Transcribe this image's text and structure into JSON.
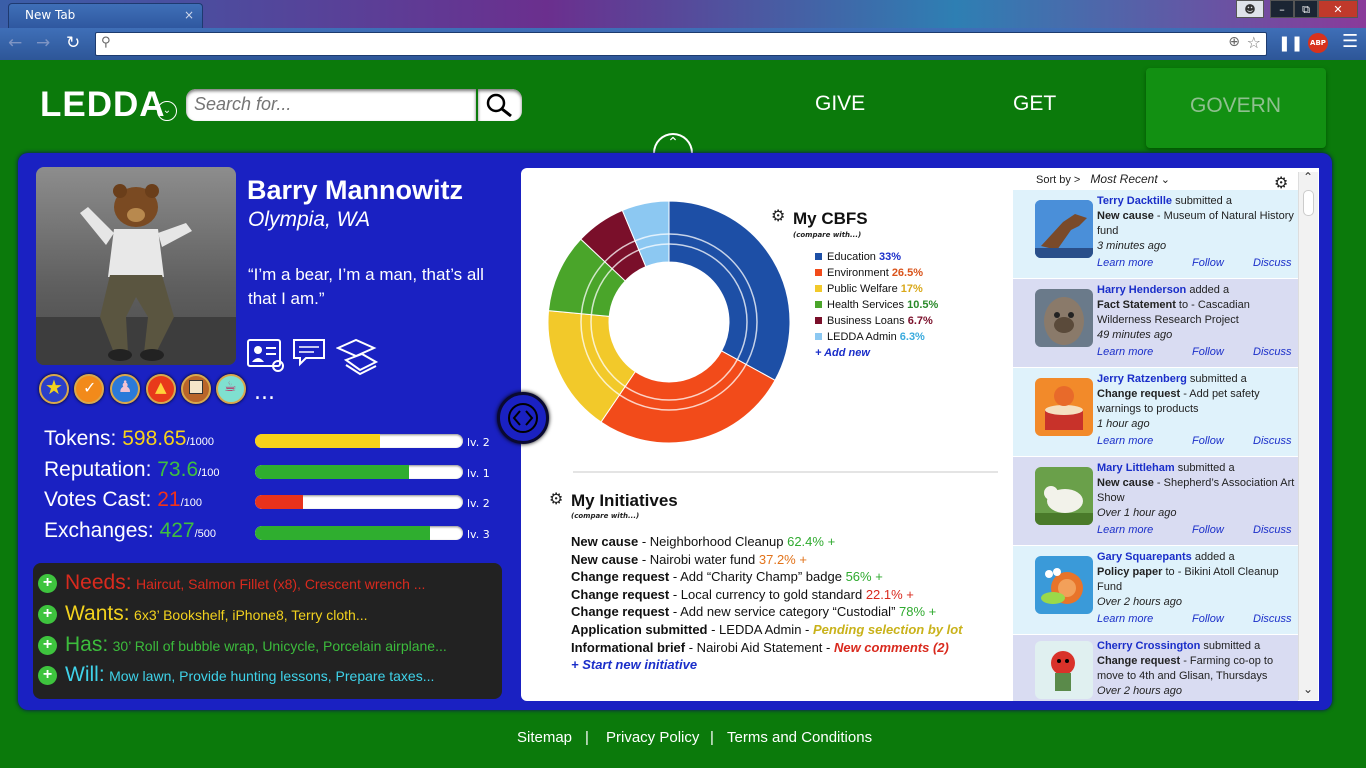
{
  "browser": {
    "tab_title": "New Tab",
    "tab_close": "×",
    "address": "",
    "extension_abp": "ABP"
  },
  "header": {
    "logo": "LEDDA",
    "search_placeholder": "Search for...",
    "nav": [
      {
        "label": "GIVE"
      },
      {
        "label": "GET"
      },
      {
        "label": "GOVERN",
        "active": true
      }
    ]
  },
  "profile": {
    "name": "Barry Mannowitz",
    "location": "Olympia, WA",
    "quote": "“I’m a bear, I’m a man, that’s all that I am.”",
    "icons": [
      "profile-settings-icon",
      "messages-icon",
      "education-icon"
    ],
    "badges": [
      "star-badge",
      "checkmark-badge",
      "person-badge",
      "fire-badge",
      "calendar-badge",
      "cup-badge"
    ],
    "badges_more": "...",
    "stats": [
      {
        "label": "Tokens: ",
        "value": "598.65",
        "max": "/1000",
        "level": "lv. 2",
        "fill": 0.6,
        "color": "#f7d21a"
      },
      {
        "label": "Reputation: ",
        "value": "73.6",
        "max": "/100",
        "level": "lv. 1",
        "fill": 0.74,
        "color": "#2fae2f"
      },
      {
        "label": "Votes Cast: ",
        "value": "21",
        "max": "/100",
        "level": "lv. 2",
        "fill": 0.23,
        "color": "#e8321c"
      },
      {
        "label": "Exchanges: ",
        "value": "427",
        "max": "/500",
        "level": "lv. 3",
        "fill": 0.84,
        "color": "#2fae2f"
      }
    ],
    "nwh": [
      {
        "key": "Needs:",
        "value": "Haircut, Salmon Fillet (x8), Crescent wrench ...",
        "color": "#d92a1e"
      },
      {
        "key": "Wants:",
        "value": "6x3’ Bookshelf, iPhone8, Terry cloth...",
        "color": "#f2d21e"
      },
      {
        "key": "Has:",
        "value": "30’ Roll of bubble wrap, Unicycle,  Porcelain airplane...",
        "color": "#3cbc3c"
      },
      {
        "key": "Will:",
        "value": "Mow lawn, Provide hunting lessons, Prepare taxes...",
        "color": "#3fd3ea"
      }
    ]
  },
  "cbfs": {
    "title": "My CBFS",
    "compare": "(compare with...)",
    "add_new": "+ Add new",
    "legend": [
      {
        "name": "Education ",
        "pct": "33%",
        "color": "#1d4fa6",
        "pct_color": "#1a2ec9"
      },
      {
        "name": "Environment ",
        "pct": "26.5%",
        "color": "#f24b1a",
        "pct_color": "#d9531a"
      },
      {
        "name": "Public Welfare ",
        "pct": "17%",
        "color": "#f2c92a",
        "pct_color": "#d9a81a"
      },
      {
        "name": "Health Services ",
        "pct": "10.5%",
        "color": "#4aa52a",
        "pct_color": "#2a8a2a"
      },
      {
        "name": "Business Loans ",
        "pct": "6.7%",
        "color": "#7a0f2a",
        "pct_color": "#7a0f2a"
      },
      {
        "name": "LEDDA Admin ",
        "pct": "6.3%",
        "color": "#8cc8f2",
        "pct_color": "#3aaadd"
      }
    ]
  },
  "initiatives": {
    "title": "My Initiatives",
    "compare": "(compare with...)",
    "items": [
      {
        "type": "New cause",
        "text": " - Neighborhood Cleanup ",
        "status": "62.4%",
        "status_color": "#2faa2f",
        "plus": " +"
      },
      {
        "type": "New cause",
        "text": " - Nairobi water fund ",
        "status": "37.2%",
        "status_color": "#e2731a",
        "plus": " +"
      },
      {
        "type": "Change request",
        "text": " - Add “Charity Champ” badge ",
        "status": "56%",
        "status_color": "#2faa2f",
        "plus": " +"
      },
      {
        "type": "Change request",
        "text": " - Local currency to gold standard ",
        "status": "22.1%",
        "status_color": "#d92a1e",
        "plus": " +"
      },
      {
        "type": "Change request",
        "text": " - Add new service category “Custodial” ",
        "status": "78%",
        "status_color": "#2faa2f",
        "plus": " +"
      },
      {
        "type": "Application submitted",
        "text": " - LEDDA Admin - ",
        "status": "Pending selection by lot",
        "status_color": "#c9b21a",
        "plus": ""
      },
      {
        "type": "Informational brief",
        "text": " - Nairobi Aid Statement - ",
        "status": "New comments (2)",
        "status_color": "#d92a1e",
        "plus": ""
      }
    ],
    "start_new": "+ Start new initiative"
  },
  "feed": {
    "sort_label": "Sort by >",
    "sort_value": "Most Recent",
    "items": [
      {
        "who": "Terry Dacktille",
        "action": " submitted a",
        "kind": "New cause",
        "target": " - Museum of Natural History fund",
        "ago": "3 minutes ago"
      },
      {
        "who": "Harry Henderson",
        "action": " added a",
        "kind": "Fact Statement",
        "target": " to - Cascadian Wilderness Research Project",
        "ago": "49 minutes ago"
      },
      {
        "who": "Jerry Ratzenberg",
        "action": " submitted a",
        "kind": "Change request",
        "target": " - Add pet safety warnings to products",
        "ago": "1 hour ago"
      },
      {
        "who": "Mary Littleham",
        "action": " submitted a",
        "kind": "New cause",
        "target": " - Shepherd’s Association Art Show",
        "ago": "Over 1 hour ago"
      },
      {
        "who": "Gary Squarepants",
        "action": " added a",
        "kind": "Policy paper",
        "target": " to - Bikini Atoll Cleanup Fund",
        "ago": "Over 2 hours ago"
      },
      {
        "who": "Cherry Crossington",
        "action": " submitted a",
        "kind": "Change request",
        "target": " - Farming co-op to move to 4th and Glisan, Thursdays",
        "ago": "Over 2 hours ago"
      }
    ],
    "links": {
      "learn": "Learn more",
      "follow": "Follow",
      "discuss": "Discuss"
    }
  },
  "footer": {
    "links": [
      "Sitemap",
      "Privacy Policy",
      "Terms and Conditions"
    ],
    "separator": "|"
  }
}
